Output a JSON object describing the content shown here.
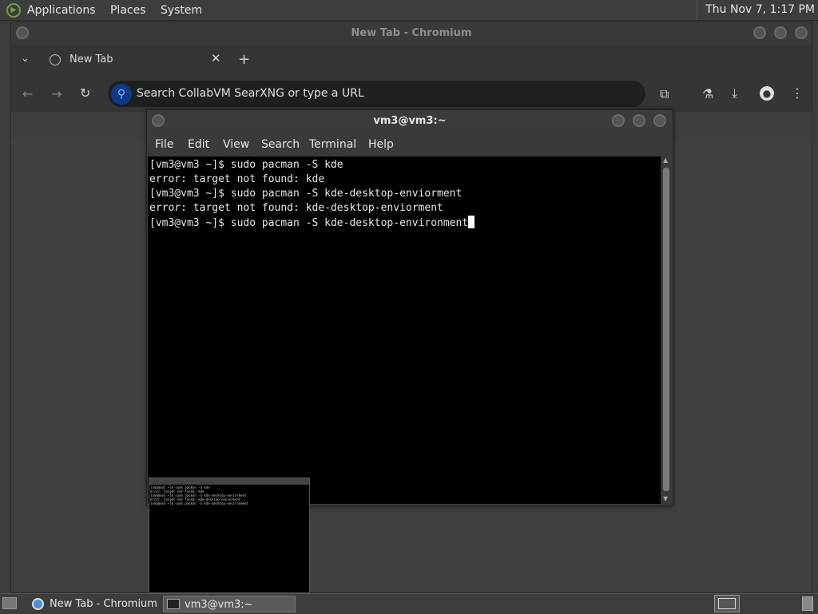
{
  "top_panel": {
    "menus": [
      "Applications",
      "Places",
      "System"
    ],
    "clock": "Thu Nov  7,  1:17 PM"
  },
  "browser": {
    "window_title": "New Tab - Chromium",
    "tab_title": "New Tab",
    "omnibox_placeholder": "Search CollabVM SearXNG or type a URL"
  },
  "terminal": {
    "window_title": "vm3@vm3:~",
    "menu": [
      "File",
      "Edit",
      "View",
      "Search",
      "Terminal",
      "Help"
    ],
    "lines": [
      "[vm3@vm3 ~]$ sudo pacman -S kde",
      "error: target not found: kde",
      "[vm3@vm3 ~]$ sudo pacman -S kde-desktop-enviorment",
      "error: target not found: kde-desktop-enviorment",
      "[vm3@vm3 ~]$ sudo pacman -S kde-desktop-environment"
    ]
  },
  "taskbar": {
    "items": [
      "New Tab - Chromium",
      "vm3@vm3:~"
    ]
  }
}
